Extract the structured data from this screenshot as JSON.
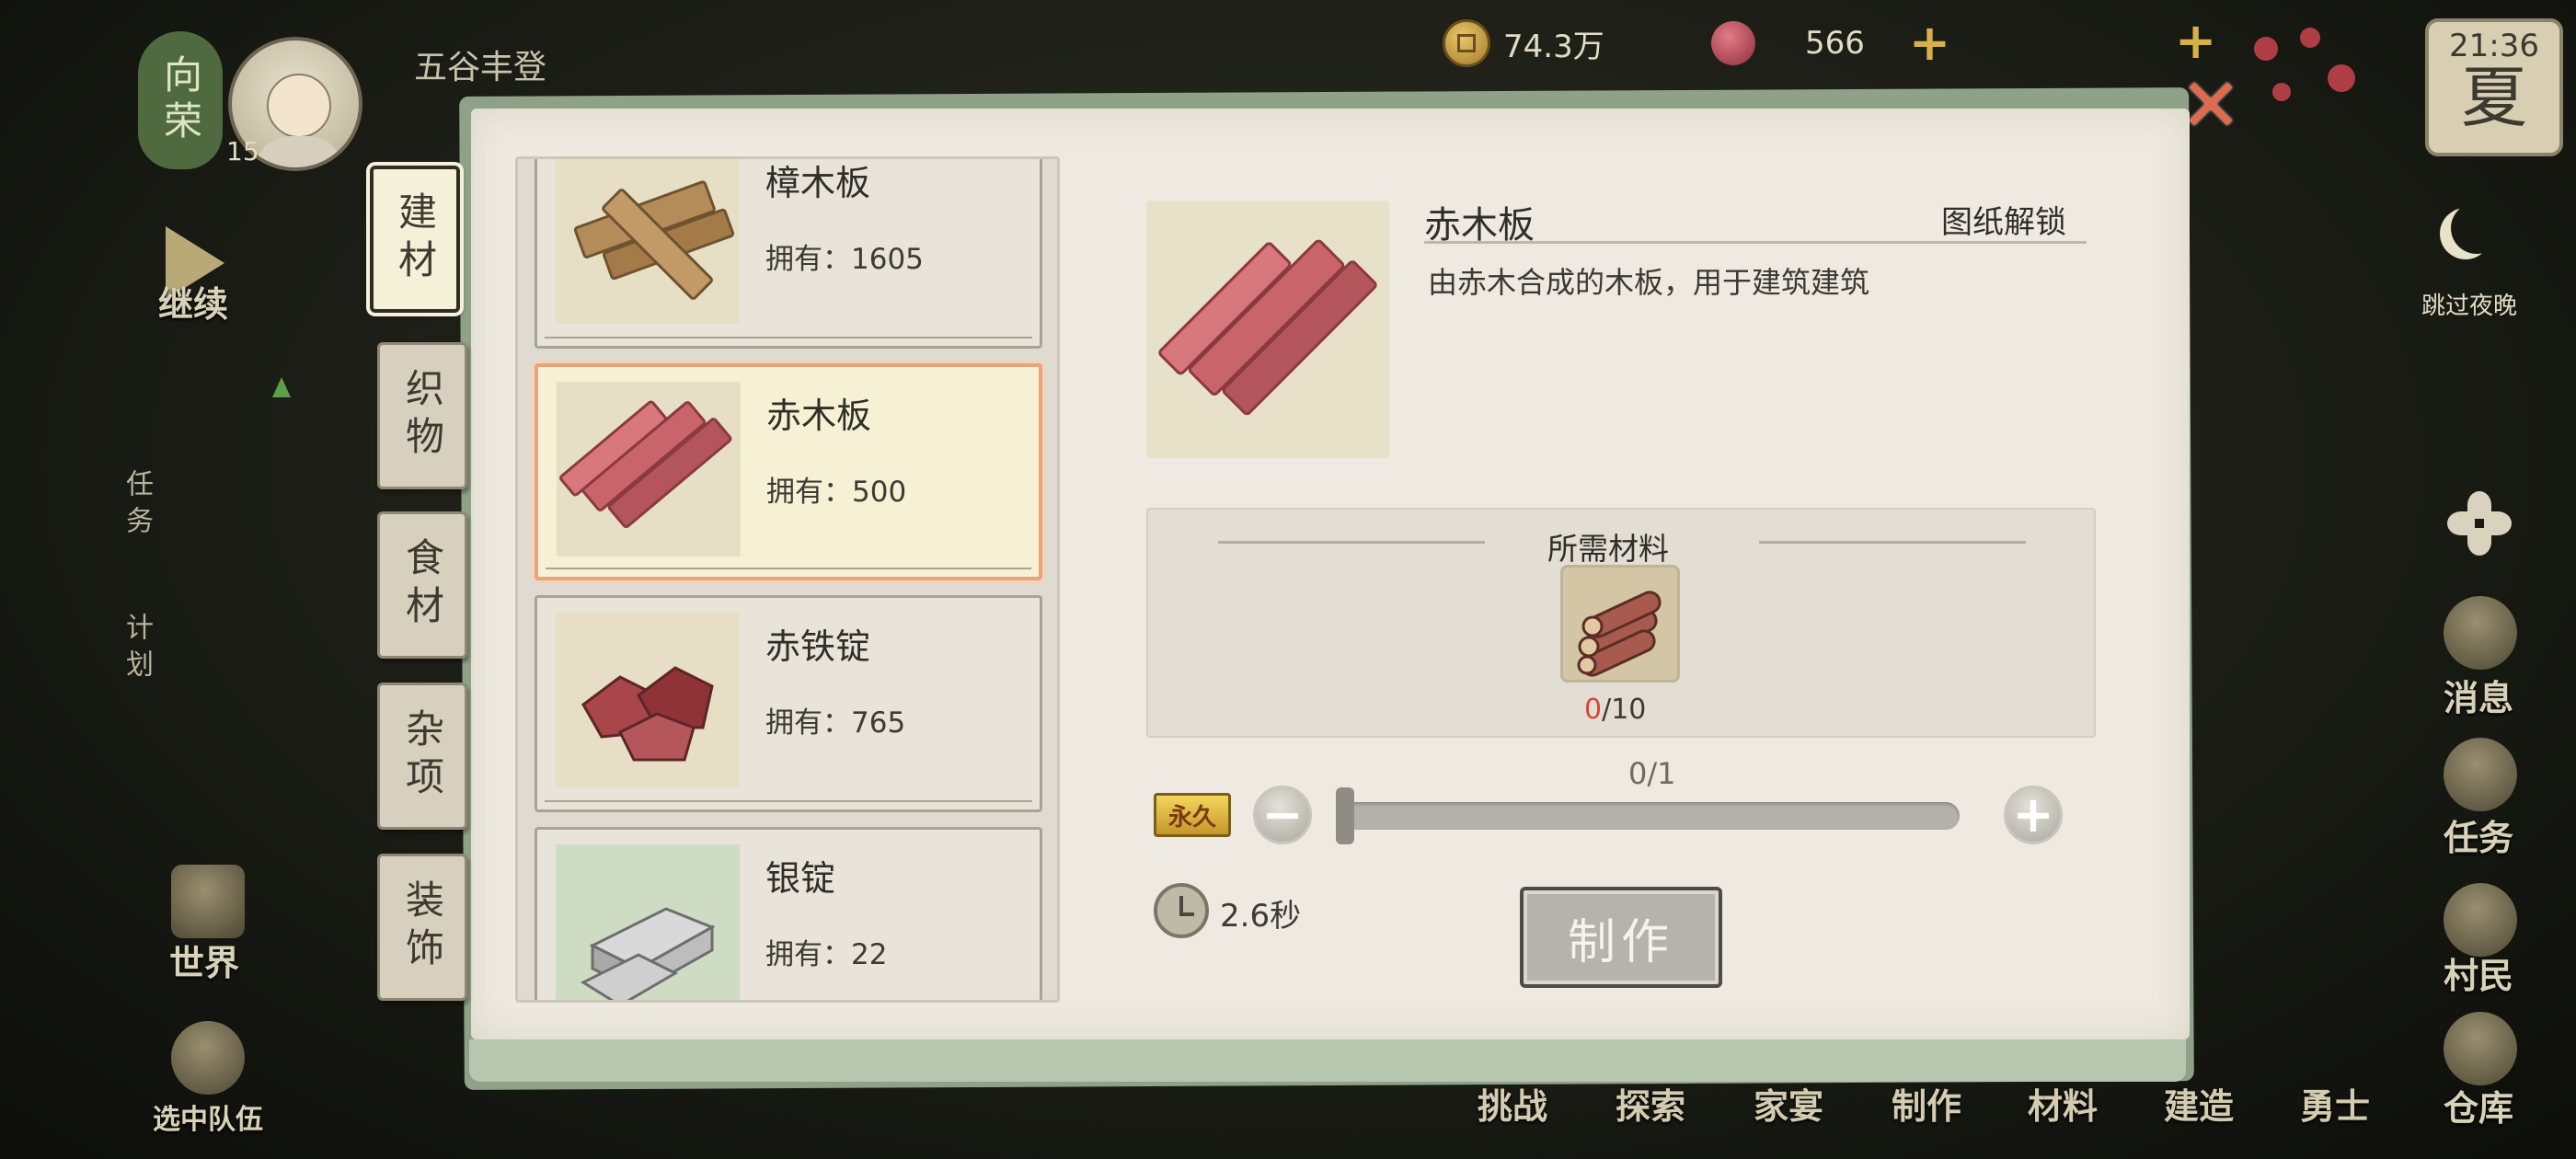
{
  "hud": {
    "title_badge": "向荣",
    "level": "15",
    "farm_status": "五谷丰登",
    "copper": "74.3万",
    "gems": "566",
    "time": "21:36",
    "season": "夏",
    "skip_night": "跳过夜晚",
    "continue": "继续",
    "task_label": "任务",
    "plan_label": "计划",
    "world": "世界",
    "select_team": "选中队伍",
    "right_side": [
      "消息",
      "任务",
      "村民",
      "仓库"
    ],
    "bottom_nav": [
      "挑战",
      "探索",
      "家宴",
      "制作",
      "材料",
      "建造",
      "勇士"
    ]
  },
  "tabs": [
    "建材",
    "织物",
    "食材",
    "杂项",
    "装饰"
  ],
  "active_tab": 0,
  "items": [
    {
      "name": "樟木板",
      "owned": "拥有：1605",
      "icon": "camphor-plank-icon"
    },
    {
      "name": "赤木板",
      "owned": "拥有：500",
      "icon": "red-plank-icon"
    },
    {
      "name": "赤铁锭",
      "owned": "拥有：765",
      "icon": "red-iron-ingot-icon"
    },
    {
      "name": "银锭",
      "owned": "拥有：22",
      "icon": "silver-ingot-icon"
    }
  ],
  "selected_index": 1,
  "detail": {
    "name": "赤木板",
    "unlock": "图纸解锁",
    "description": "由赤木合成的木板，用于建筑建筑",
    "materials_title": "所需材料",
    "material_have": "0",
    "material_need": "/10",
    "material_icon": "red-wood-logs-icon",
    "quantity": "0/1",
    "quantity_fraction": 0,
    "permanent_badge": "永久",
    "craft_time": "2.6秒",
    "craft_button": "制作"
  },
  "colors": {
    "accent_frame": "#8ea287",
    "selected_border": "#e8a47c",
    "close": "#e06a4e",
    "missing": "#d6463b"
  }
}
